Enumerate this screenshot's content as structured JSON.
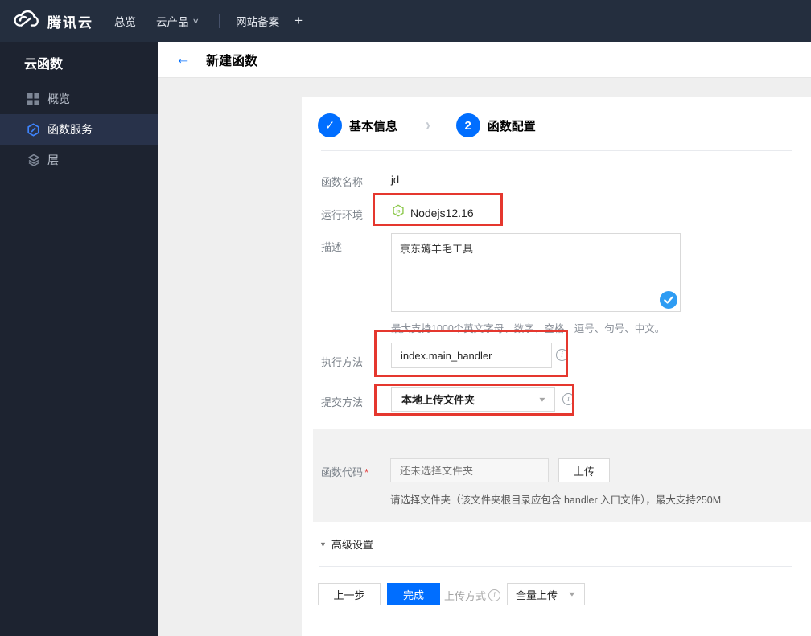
{
  "topbar": {
    "brand": "腾讯云",
    "nav": [
      {
        "label": "总览"
      },
      {
        "label": "云产品"
      },
      {
        "label": "网站备案"
      },
      {
        "label": "+"
      }
    ]
  },
  "sidebar": {
    "title": "云函数",
    "items": [
      {
        "label": "概览",
        "icon": "grid-icon"
      },
      {
        "label": "函数服务",
        "icon": "scf-hexagon-icon",
        "active": true
      },
      {
        "label": "层",
        "icon": "layers-icon"
      }
    ]
  },
  "header": {
    "back": "←",
    "title": "新建函数"
  },
  "steps": {
    "step1_label": "基本信息",
    "step1_state": "done",
    "step2_number": "2",
    "step2_label": "函数配置"
  },
  "form": {
    "name_label": "函数名称",
    "name_value": "jd",
    "runtime_label": "运行环境",
    "runtime_value": "Nodejs12.16",
    "desc_label": "描述",
    "desc_value": "京东薅羊毛工具",
    "desc_hint": "最大支持1000个英文字母、数字、空格、逗号、句号、中文。",
    "handler_label": "执行方法",
    "handler_value": "index.main_handler",
    "submit_label": "提交方法",
    "submit_value": "本地上传文件夹",
    "code_label": "函数代码",
    "required_mark": "*",
    "code_placeholder": "还未选择文件夹",
    "upload_button": "上传",
    "code_hint": "请选择文件夹（该文件夹根目录应包含 handler 入口文件），最大支持250M",
    "advanced_label": "高级设置"
  },
  "footer": {
    "prev": "上一步",
    "finish": "完成",
    "upload_mode_label": "上传方式",
    "upload_mode_value": "全量上传"
  },
  "icons": {
    "check": "✓",
    "chevron_right": "›",
    "caret_down": "∨",
    "dropdown_caret": "▼",
    "triangle_down": "▼",
    "info": "i"
  },
  "colors": {
    "accent_blue": "#006eff",
    "annotation_red": "#e5372e",
    "node_green": "#8cc84b",
    "check_blue": "#2e9cf3",
    "topbar_bg": "#242e3e",
    "sidebar_bg": "#1d2330",
    "sidebar_active_bg": "#28324a"
  }
}
